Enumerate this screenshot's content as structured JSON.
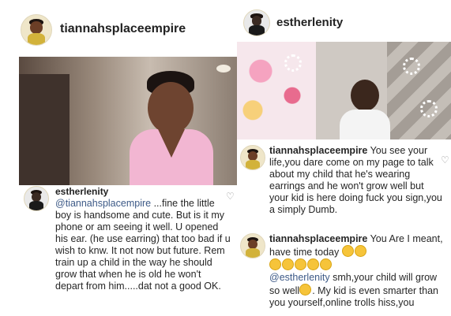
{
  "left": {
    "handle": "tiannahsplaceempire",
    "comment": {
      "author": "estherlenity",
      "mention": "@tiannahsplacempire",
      "text": " ...fine the little boy is handsome and cute. But is it my phone or am seeing it well. U opened his ear. (he use earring) that too bad if u wish to knw. It not now but future. Rem train up a child in the way he should grow that when he is old he won't depart from him.....dat not a good OK."
    }
  },
  "right": {
    "handle": "estherlenity",
    "comment1": {
      "author": "tiannahsplaceempire",
      "text": " You see your life,you dare come on my page to talk about my child that he's wearing earrings and he won't grow well but your kid is here doing fuck you sign,you a simply Dumb."
    },
    "comment2": {
      "author": "tiannahsplaceempire",
      "text_a": " You Are I meant, have time today",
      "mention": "@estherlenity",
      "text_b": " smh,your child will grow so well",
      "text_c": ". My kid is even smarter than you yourself,online trolls hiss,you"
    }
  },
  "icons": {
    "like": "heart-icon",
    "emoji": "laughing-emoji-icon"
  }
}
